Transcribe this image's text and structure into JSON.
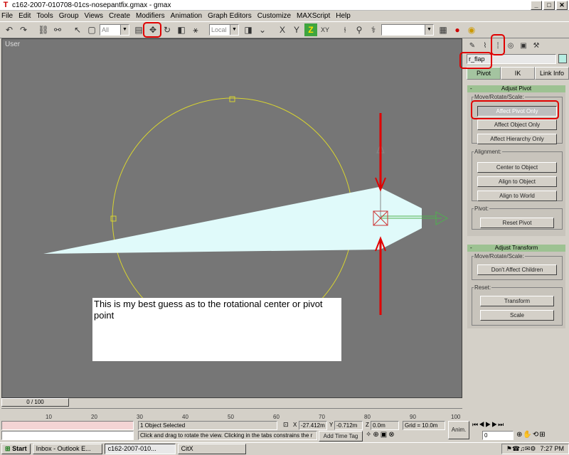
{
  "window": {
    "title": "c162-2007-010708-01cs-nosepantfix.gmax - gmax",
    "app_icon": "gmax-app-icon",
    "controls": [
      "_",
      "□",
      "✕"
    ]
  },
  "menu": [
    "File",
    "Edit",
    "Tools",
    "Group",
    "Views",
    "Create",
    "Modifiers",
    "Animation",
    "Graph Editors",
    "Customize",
    "MAXScript",
    "Help"
  ],
  "toolbar": {
    "selection_filter": "All",
    "reference_coord": "Local",
    "constraint_labels": [
      "X",
      "Y",
      "Z",
      "XY"
    ],
    "named_selection": ""
  },
  "viewport": {
    "label": "User",
    "axis_z": "z",
    "axis_x": "x",
    "axis_y": "y",
    "note": "This is my best guess as to the rotational center or pivot point"
  },
  "command_panel": {
    "object_name": "r_flap",
    "object_color": "#b7ede2",
    "tabs": [
      "Pivot",
      "IK",
      "Link Info"
    ],
    "adjust_pivot": {
      "title": "Adjust Pivot",
      "group_move": "Move/Rotate/Scale:",
      "btn_pivot_only": "Affect Pivot Only",
      "btn_object_only": "Affect Object Only",
      "btn_hierarchy_only": "Affect Hierarchy Only",
      "group_alignment": "Alignment:",
      "btn_center": "Center to Object",
      "btn_align_object": "Align to Object",
      "btn_align_world": "Align to World",
      "group_pivot": "Pivot:",
      "btn_reset_pivot": "Reset Pivot"
    },
    "adjust_transform": {
      "title": "Adjust Transform",
      "group_move": "Move/Rotate/Scale:",
      "btn_dont_affect": "Don't Affect Children",
      "group_reset": "Reset:",
      "btn_transform": "Transform",
      "btn_scale": "Scale"
    }
  },
  "timeline": {
    "slider": "0 / 100",
    "ticks": [
      "10",
      "20",
      "30",
      "40",
      "50",
      "60",
      "70",
      "80",
      "90",
      "100"
    ]
  },
  "status": {
    "selected": "1 Object Selected",
    "prompt": "Click and drag to rotate the view.  Clicking in the tabs constrains the r",
    "x_label": "X",
    "x_value": "-27.412m",
    "y_label": "Y",
    "y_value": "-0.712m",
    "z_label": "Z",
    "z_value": "0.0m",
    "grid": "Grid = 10.0m",
    "add_time_tag": "Add Time Tag",
    "anim": "Anim.",
    "frame": "0"
  },
  "taskbar": {
    "start": "Start",
    "tasks": [
      "Inbox - Outlook E...",
      "c162-2007-010...",
      "CitX"
    ],
    "clock": "7:27 PM"
  }
}
